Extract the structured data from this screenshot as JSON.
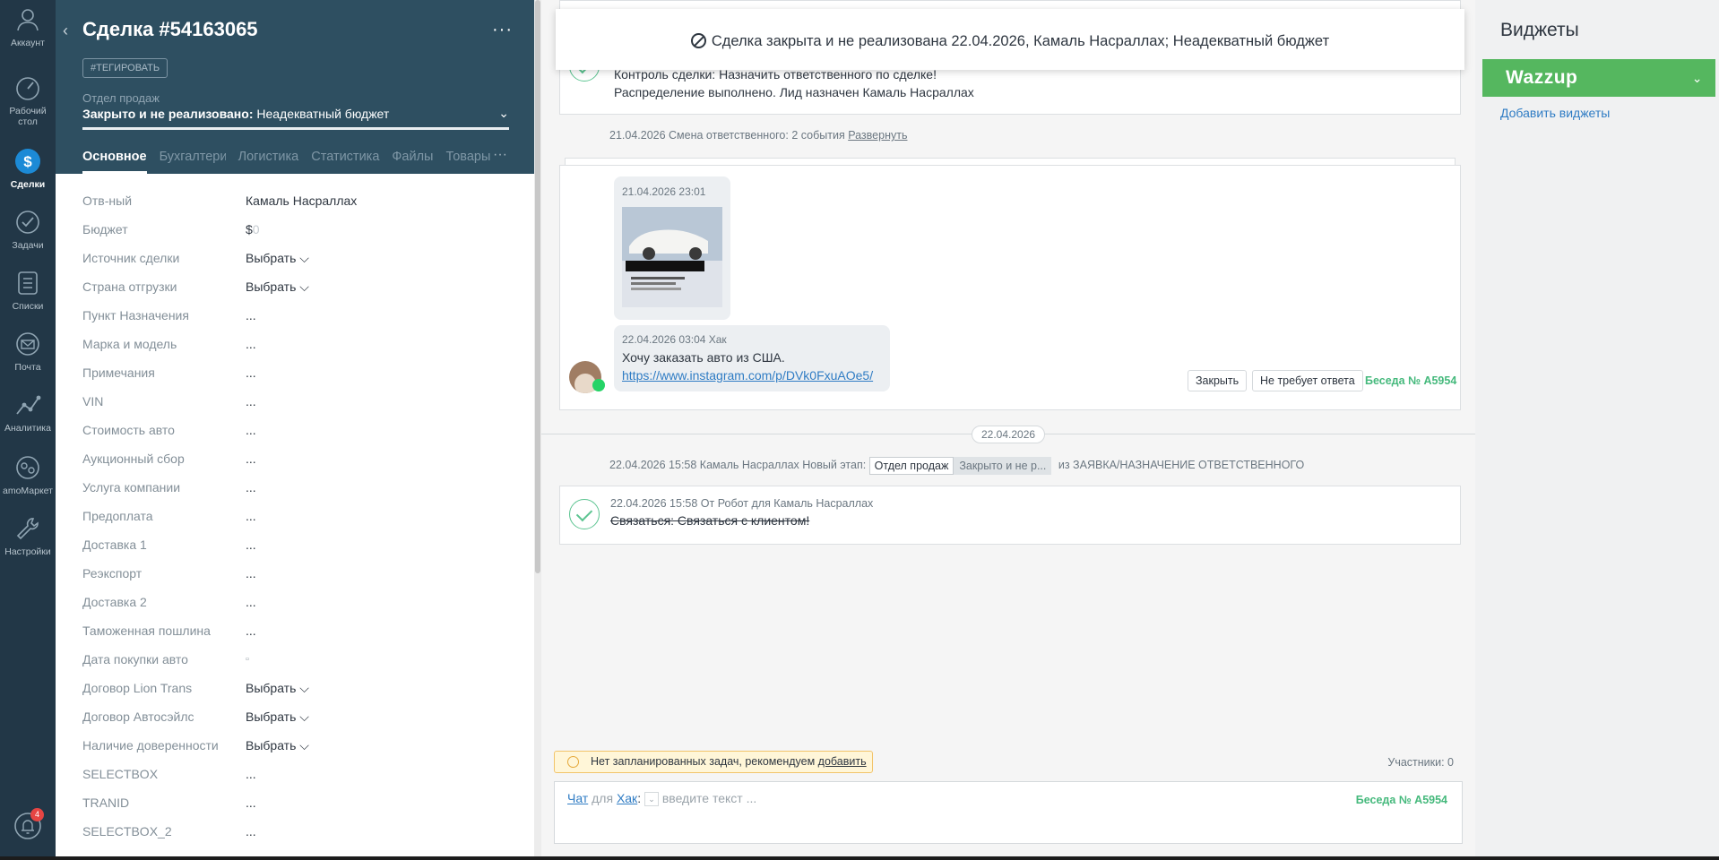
{
  "nav": {
    "items": [
      {
        "label": "Аккаунт",
        "icon": "account-icon"
      },
      {
        "label": "Рабочий стол",
        "icon": "dashboard-icon"
      },
      {
        "label": "Сделки",
        "icon": "deals-icon"
      },
      {
        "label": "Задачи",
        "icon": "tasks-icon"
      },
      {
        "label": "Списки",
        "icon": "lists-icon"
      },
      {
        "label": "Почта",
        "icon": "mail-icon"
      },
      {
        "label": "Аналитика",
        "icon": "analytics-icon"
      },
      {
        "label": "amoМаркет",
        "icon": "market-icon"
      },
      {
        "label": "Настройки",
        "icon": "settings-icon"
      }
    ],
    "notifications_count": "4"
  },
  "card": {
    "title": "Сделка #54163065",
    "tag_button": "#ТЕГИРОВАТЬ",
    "pipeline": "Отдел продаж",
    "status_bold": "Закрыто и не реализовано:",
    "status_reason": " Неадекватный бюджет",
    "tabs": [
      "Основное",
      "Бухгалтерия",
      "Логистика",
      "Статистика",
      "Файлы",
      "Товары"
    ],
    "fields": [
      {
        "label": "Отв-ный",
        "value": "Камаль Насраллах"
      },
      {
        "label": "Бюджет",
        "value": "$",
        "extra": "0"
      },
      {
        "label": "Источник сделки",
        "value": "Выбрать ⌵"
      },
      {
        "label": "Страна отгрузки",
        "value": "Выбрать ⌵"
      },
      {
        "label": "Пункт Назначения",
        "value": "..."
      },
      {
        "label": "Марка и модель",
        "value": "..."
      },
      {
        "label": "Примечания",
        "value": "..."
      },
      {
        "label": "VIN",
        "value": "..."
      },
      {
        "label": "Стоимость авто",
        "value": "..."
      },
      {
        "label": "Аукционный сбор",
        "value": "..."
      },
      {
        "label": "Услуга компании",
        "value": "..."
      },
      {
        "label": "Предоплата",
        "value": "..."
      },
      {
        "label": "Доставка 1",
        "value": "..."
      },
      {
        "label": "Реэкспорт",
        "value": "..."
      },
      {
        "label": "Доставка 2",
        "value": "..."
      },
      {
        "label": "Таможенная пошлина",
        "value": "..."
      },
      {
        "label": "Дата покупки авто",
        "value": "▫"
      },
      {
        "label": "Договор Lion Trans",
        "value": "Выбрать ⌵"
      },
      {
        "label": "Договор Автосэйлс",
        "value": "Выбрать ⌵"
      },
      {
        "label": "Наличие доверенности",
        "value": "Выбрать ⌵"
      },
      {
        "label": "SELECTBOX",
        "value": "..."
      },
      {
        "label": "TRANID",
        "value": "..."
      },
      {
        "label": "SELECTBOX_2",
        "value": "..."
      }
    ]
  },
  "feed": {
    "banner": "Сделка закрыта и не реализована 22.04.2026, Камаль Насраллах; Неадекватный бюджет",
    "top_event_line1": "Контроль сделки: Назначить ответственного по сделке!",
    "top_event_line2": "Распределение выполнено. Лид назначен Камаль Насраллах",
    "resp_change": "21.04.2026 Смена ответственного: 2 события",
    "resp_expand": "Развернуть",
    "msg1_time": "21.04.2026 23:01",
    "msg2_meta": "22.04.2026 03:04 Хак",
    "msg2_text": "Хочу заказать авто из США.",
    "msg2_link": "https://www.instagram.com/p/DVk0FxuAOe5/",
    "close_btn": "Закрыть",
    "no_reply_btn": "Не требует ответа",
    "conversation": "Беседа № A5954",
    "date_divider": "22.04.2026",
    "stage_prefix": "22.04.2026 15:58 Камаль Насраллах Новый этап:",
    "stage_chip1": "Отдел продаж",
    "stage_chip2": "Закрыто и не р...",
    "stage_suffix": "из ЗАЯВКА/НАЗНАЧЕНИЕ ОТВЕТСТВЕННОГО",
    "task_meta": "22.04.2026 15:58  От Робот для Камаль Насраллах",
    "task_text": "Связаться: Связаться с клиентом!",
    "warn_text": "Нет запланированных задач, рекомендуем ",
    "warn_link": "добавить",
    "participants": "Участники: 0",
    "chat_label": "Чат",
    "chat_for": "для",
    "chat_user": "Хак",
    "chat_placeholder": "введите текст ...",
    "chat_conversation": "Беседа № A5954"
  },
  "widgets": {
    "title": "Виджеты",
    "wazzup": "Wazzup",
    "add": "Добавить виджеты"
  },
  "colors": {
    "nav_bg": "#223747",
    "card_head_bg": "#2e4f61",
    "accent_green": "#55b75f",
    "link_blue": "#2f7cc4"
  }
}
